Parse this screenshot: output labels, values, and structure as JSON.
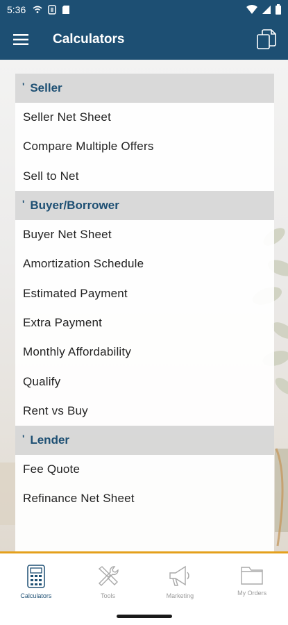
{
  "status_bar": {
    "time": "5:36"
  },
  "app_bar": {
    "title": "Calculators"
  },
  "sections": [
    {
      "title": "Seller",
      "items": [
        "Seller Net Sheet",
        "Compare Multiple Offers",
        "Sell to Net"
      ]
    },
    {
      "title": "Buyer/Borrower",
      "items": [
        "Buyer Net Sheet",
        "Amortization Schedule",
        "Estimated Payment",
        "Extra Payment",
        "Monthly Affordability",
        "Qualify",
        "Rent vs Buy"
      ]
    },
    {
      "title": "Lender",
      "items": [
        "Fee Quote",
        "Refinance Net Sheet"
      ]
    }
  ],
  "bottom_nav": [
    {
      "label": "Calculators",
      "icon": "calculator-icon",
      "active": true
    },
    {
      "label": "Tools",
      "icon": "tools-icon",
      "active": false
    },
    {
      "label": "Marketing",
      "icon": "megaphone-icon",
      "active": false
    },
    {
      "label": "My Orders",
      "icon": "folder-icon",
      "active": false
    }
  ],
  "colors": {
    "primary": "#1d4f73",
    "accent": "#e4a01c"
  }
}
